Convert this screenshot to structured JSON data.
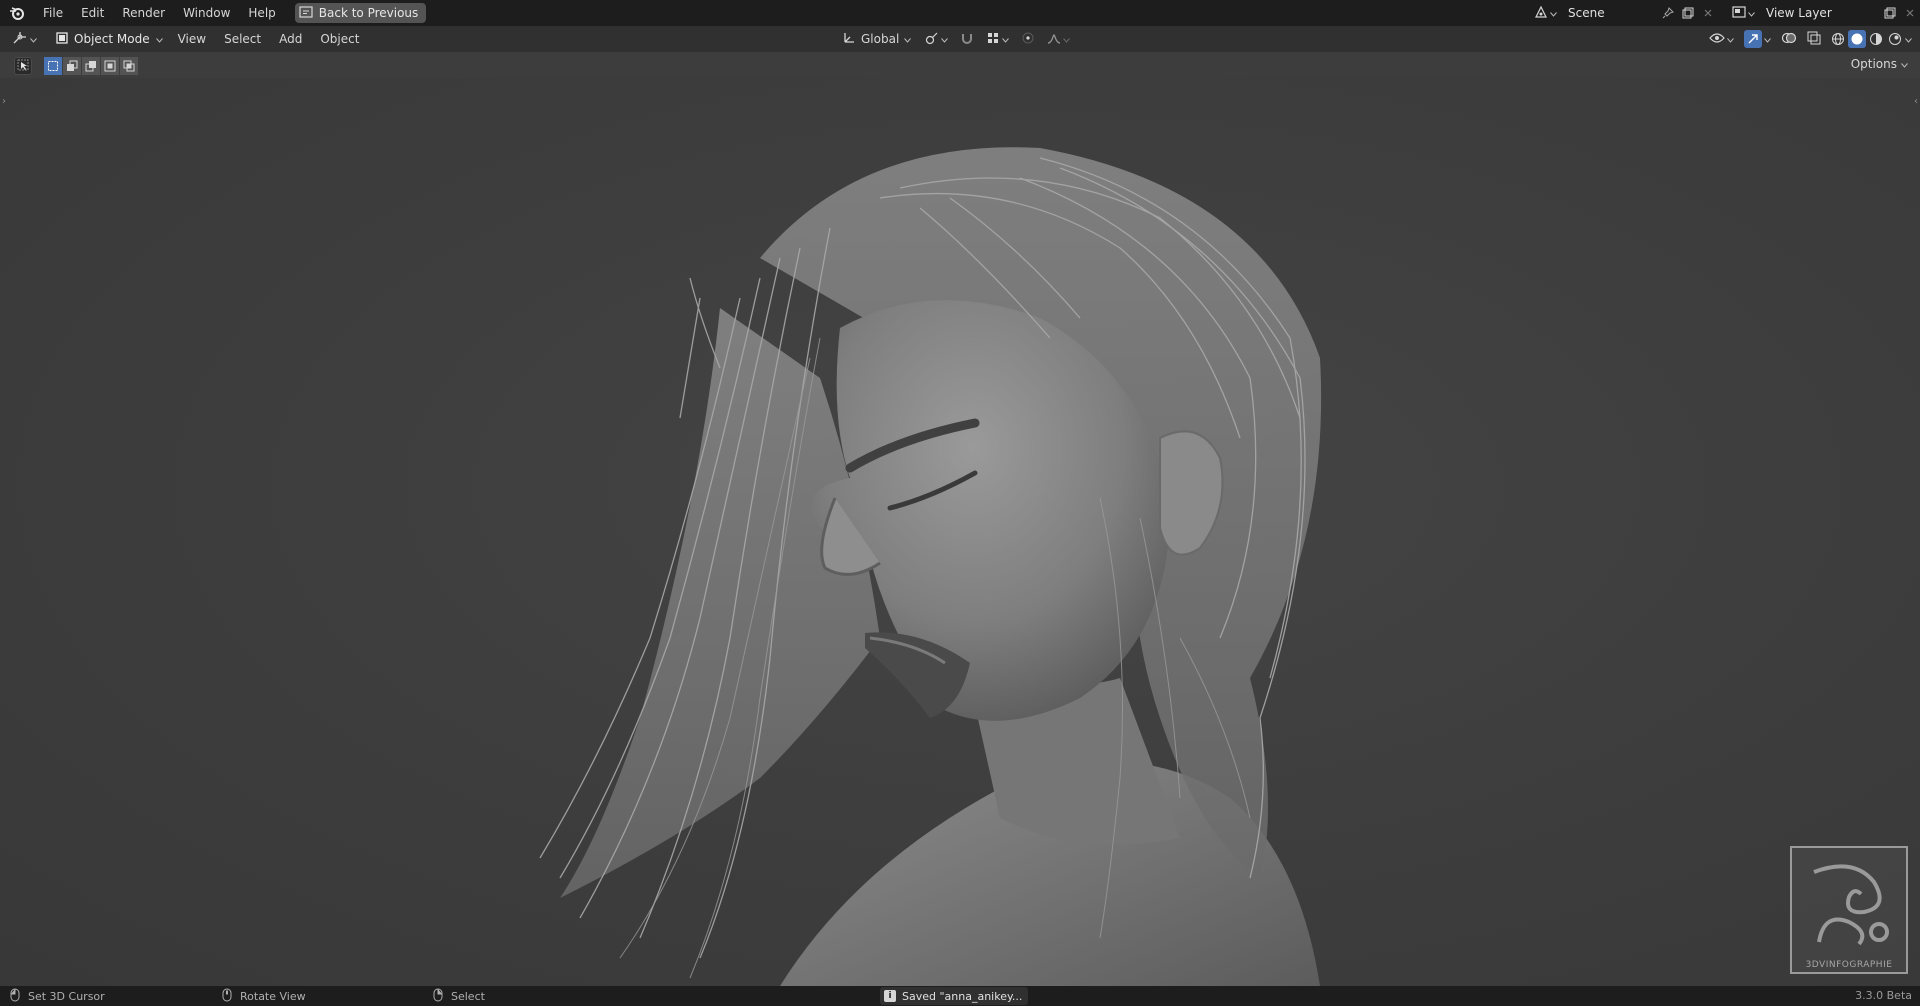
{
  "topbar": {
    "menus": [
      "File",
      "Edit",
      "Render",
      "Window",
      "Help"
    ],
    "back_button": "Back to Previous",
    "scene": "Scene",
    "view_layer": "View Layer"
  },
  "header": {
    "mode": "Object Mode",
    "menus": [
      "View",
      "Select",
      "Add",
      "Object"
    ],
    "orientation": "Global"
  },
  "toolbar": {
    "options": "Options"
  },
  "viewport": {
    "watermark": "3DVINFOGRAPHIE"
  },
  "statusbar": {
    "left_click": "Set 3D Cursor",
    "middle_click": "Rotate View",
    "right_click": "Select",
    "message": "Saved \"anna_anikey...",
    "version": "3.3.0 Beta"
  },
  "colors": {
    "accent": "#4772b3",
    "background": "#3d3d3d",
    "header": "#303030",
    "topbar": "#1d1d1d"
  }
}
